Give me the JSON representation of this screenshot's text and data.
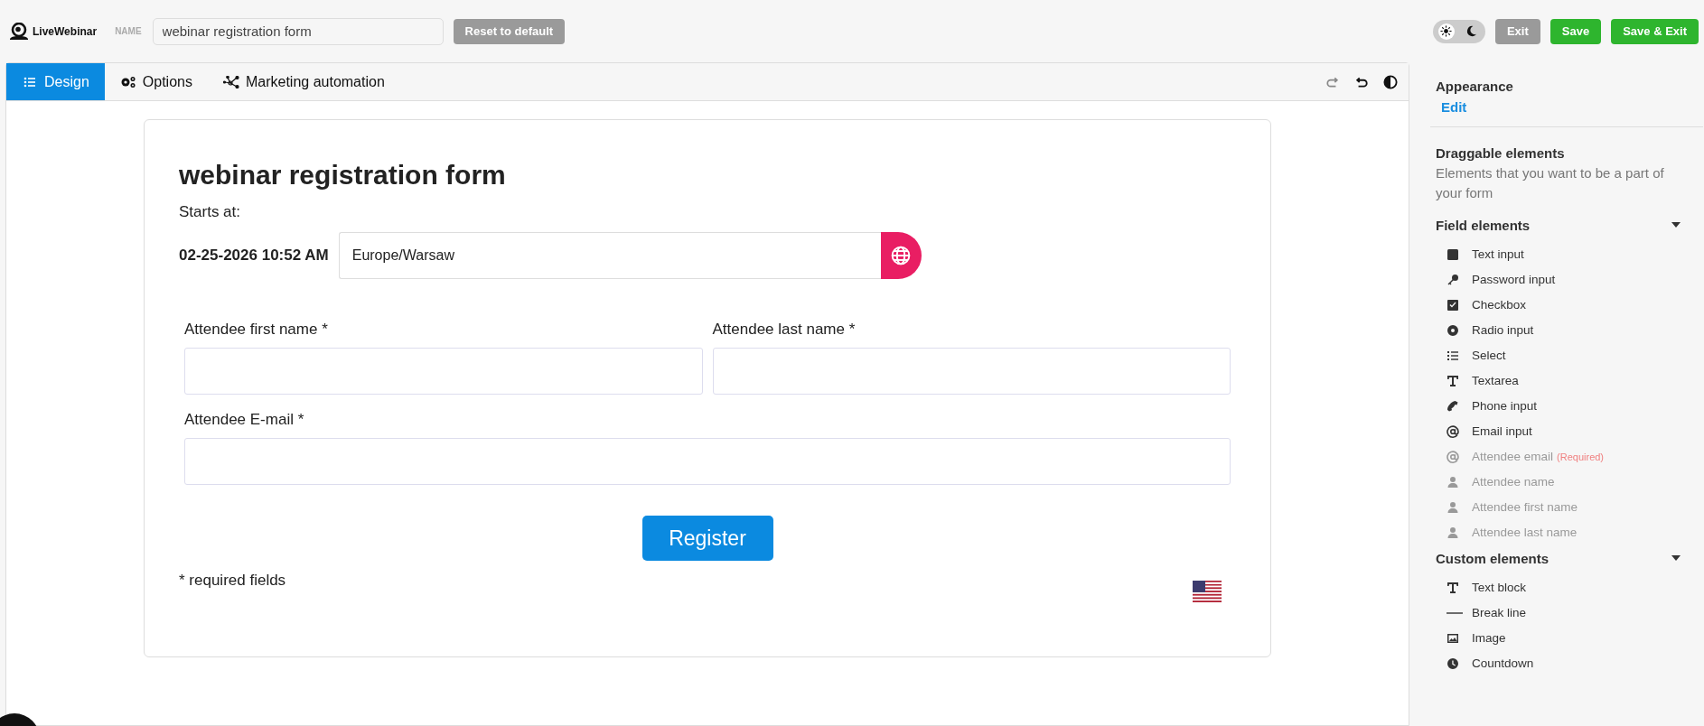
{
  "logo": {
    "text": "LiveWebinar"
  },
  "name_field": {
    "label": "NAME",
    "value": "webinar registration form"
  },
  "reset_button": "Reset to default",
  "theme_toggle": [
    {
      "kind": "light",
      "selected": true
    },
    {
      "kind": "dark",
      "selected": false
    }
  ],
  "header_buttons": [
    {
      "label": "Exit",
      "kind": "secondary"
    },
    {
      "label": "Save",
      "kind": "primary"
    },
    {
      "label": "Save & Exit",
      "kind": "primary"
    }
  ],
  "tabs": [
    {
      "label": "Design",
      "kind": "list",
      "selected": true
    },
    {
      "label": "Options",
      "kind": "gears",
      "selected": false
    },
    {
      "label": "Marketing automation",
      "kind": "network",
      "selected": false
    }
  ],
  "toolbar": [
    {
      "kind": "redo"
    },
    {
      "kind": "undo"
    },
    {
      "kind": "contrast"
    }
  ],
  "form": {
    "title": "webinar registration form",
    "starts_label": "Starts at:",
    "start_date": "02-25-2026 10:52 AM",
    "timezone": "Europe/Warsaw",
    "fields": [
      {
        "label": "Attendee first name *",
        "kind": "half"
      },
      {
        "label": "Attendee last name *",
        "kind": "half"
      },
      {
        "label": "Attendee E-mail *",
        "kind": "full"
      }
    ],
    "submit": "Register",
    "footnote": "* required fields"
  },
  "sidebar": {
    "appearance": {
      "title": "Appearance",
      "link": "Edit"
    },
    "draggable": {
      "title": "Draggable elements",
      "description": "Elements that you want to be a part of your form"
    },
    "sections": [
      {
        "title": "Field elements",
        "expanded": true,
        "items": [
          {
            "label": "Text input",
            "kind": "square",
            "disabled": false
          },
          {
            "label": "Password input",
            "kind": "key",
            "disabled": false
          },
          {
            "label": "Checkbox",
            "kind": "checkbox",
            "disabled": false
          },
          {
            "label": "Radio input",
            "kind": "radio",
            "disabled": false
          },
          {
            "label": "Select",
            "kind": "list",
            "disabled": false
          },
          {
            "label": "Textarea",
            "kind": "text",
            "disabled": false
          },
          {
            "label": "Phone input",
            "kind": "phone",
            "disabled": false
          },
          {
            "label": "Email input",
            "kind": "at",
            "disabled": false
          },
          {
            "label": "Attendee email",
            "note": "(Required)",
            "kind": "at",
            "disabled": true
          },
          {
            "label": "Attendee name",
            "kind": "user",
            "disabled": true
          },
          {
            "label": "Attendee first name",
            "kind": "user",
            "disabled": true
          },
          {
            "label": "Attendee last name",
            "kind": "user",
            "disabled": true
          }
        ]
      },
      {
        "title": "Custom elements",
        "expanded": true,
        "items": [
          {
            "label": "Text block",
            "kind": "text",
            "disabled": false
          },
          {
            "label": "Break line",
            "kind": "line",
            "disabled": false
          },
          {
            "label": "Image",
            "kind": "image",
            "disabled": false
          },
          {
            "label": "Countdown",
            "kind": "clock",
            "disabled": false
          }
        ]
      }
    ]
  }
}
